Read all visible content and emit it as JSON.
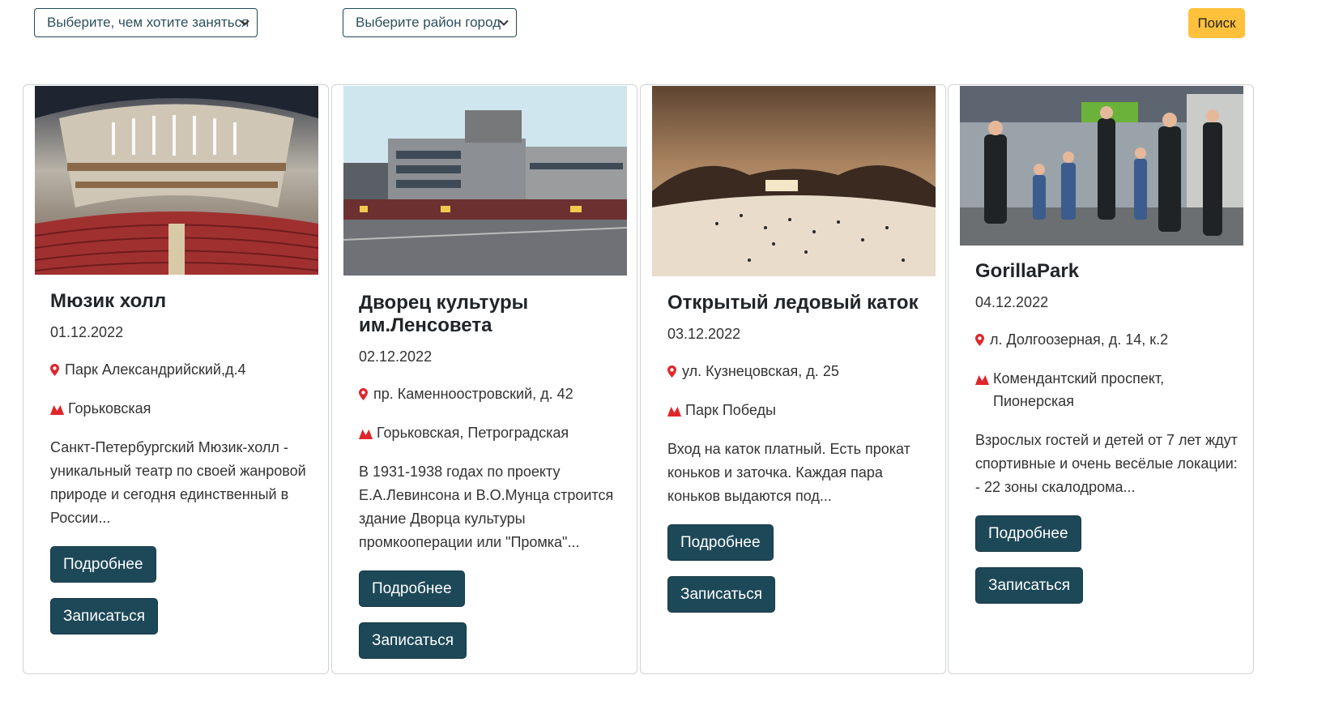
{
  "filters": {
    "activity_select": "Выберите, чем хотите заняться",
    "district_select": "Выберите район город",
    "search_label": "Поиск"
  },
  "colors": {
    "button_primary": "#1d4858",
    "button_search": "#ffc13b",
    "icon_red": "#e0262b"
  },
  "cards": [
    {
      "image": "concert-hall-interior-photo",
      "title": "Мюзик холл",
      "date": "01.12.2022",
      "address": "Парк Александрийский,д.4",
      "metro": "Горьковская",
      "description": "Санкт-Петербургский Мюзик-холл - уникальный театр по своей жанровой природе и сегодня единственный в России...",
      "details_label": "Подробнее",
      "signup_label": "Записаться"
    },
    {
      "image": "palace-of-culture-street-photo",
      "title": "Дворец культуры им.Ленсовета",
      "date": "02.12.2022",
      "address": "пр. Каменноостровский, д. 42",
      "metro": "Горьковская, Петроградская",
      "description": "В 1931-1938 годах по проекту Е.А.Левинсона и В.О.Мунца строится здание Дворца культуры промкооперации или \"Промка\"...",
      "details_label": "Подробнее",
      "signup_label": "Записаться"
    },
    {
      "image": "outdoor-ice-rink-night-photo",
      "title": "Открытый ледовый каток",
      "date": "03.12.2022",
      "address": "ул. Кузнецовская, д. 25",
      "metro": "Парк Победы",
      "description": "Вход на каток платный. Есть прокат коньков и заточка. Каждая пара коньков выдаются под...",
      "details_label": "Подробнее",
      "signup_label": "Записаться"
    },
    {
      "image": "kids-activity-park-photo",
      "title": "GorillaPark",
      "date": "04.12.2022",
      "address": "л. Долгоозерная, д. 14, к.2",
      "metro": "Комендантский проспект, Пионерская",
      "description": "Взрослых гостей и детей от 7 лет ждут спортивные и очень весёлые локации: - 22 зоны скалодрома...",
      "details_label": "Подробнее",
      "signup_label": "Записаться"
    }
  ]
}
